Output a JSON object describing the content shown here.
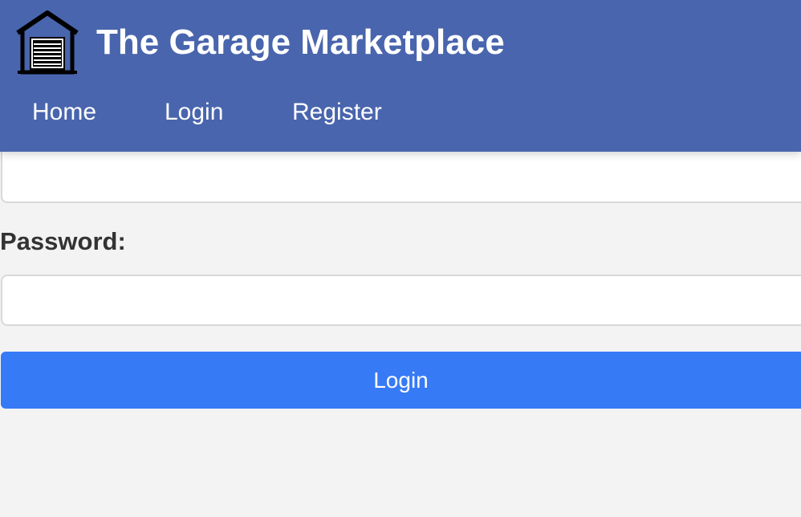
{
  "header": {
    "logo_icon": "garage-icon",
    "title": "The Garage Marketplace",
    "background_color": "#4965ad",
    "nav": {
      "home": "Home",
      "login": "Login",
      "register": "Register"
    }
  },
  "form": {
    "username": {
      "value": "",
      "placeholder": ""
    },
    "password": {
      "label": "Password:",
      "value": "",
      "placeholder": ""
    },
    "submit": {
      "label": "Login",
      "color": "#367af6"
    }
  }
}
